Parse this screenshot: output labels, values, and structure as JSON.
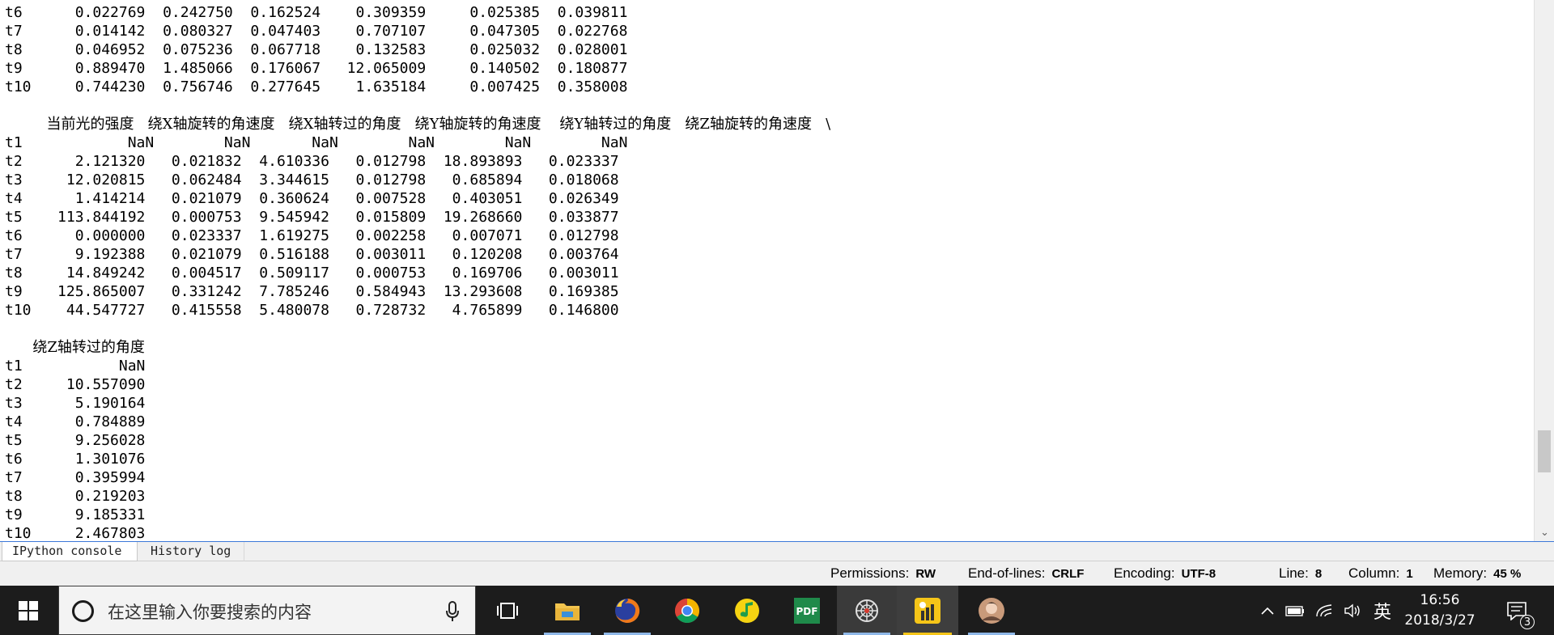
{
  "console": {
    "lines": [
      "t6      0.022769  0.242750  0.162524    0.309359     0.025385  0.039811",
      "t7      0.014142  0.080327  0.047403    0.707107     0.047305  0.022768",
      "t8      0.046952  0.075236  0.067718    0.132583     0.025032  0.028001",
      "t9      0.889470  1.485066  0.176067   12.065009     0.140502  0.180877",
      "t10     0.744230  0.756746  0.277645    1.635184     0.007425  0.358008",
      "",
      "         当前光的强度   绕X轴旋转的角速度   绕X轴转过的角度   绕Y轴旋转的角速度    绕Y轴转过的角度   绕Z轴旋转的角速度   \\",
      "t1            NaN        NaN       NaN        NaN        NaN        NaN",
      "t2      2.121320   0.021832  4.610336   0.012798  18.893893   0.023337",
      "t3     12.020815   0.062484  3.344615   0.012798   0.685894   0.018068",
      "t4      1.414214   0.021079  0.360624   0.007528   0.403051   0.026349",
      "t5    113.844192   0.000753  9.545942   0.015809  19.268660   0.033877",
      "t6      0.000000   0.023337  1.619275   0.002258   0.007071   0.012798",
      "t7      9.192388   0.021079  0.516188   0.003011   0.120208   0.003764",
      "t8     14.849242   0.004517  0.509117   0.000753   0.169706   0.003011",
      "t9    125.865007   0.331242  7.785246   0.584943  13.293608   0.169385",
      "t10    44.547727   0.415558  5.480078   0.728732   4.765899   0.146800",
      "",
      "      绕Z轴转过的角度",
      "t1           NaN",
      "t2     10.557090",
      "t3      5.190164",
      "t4      0.784889",
      "t5      9.256028",
      "t6      1.301076",
      "t7      0.395994",
      "t8      0.219203",
      "t9      9.185331",
      "t10     2.467803"
    ],
    "scroll_down_glyph": "⌄"
  },
  "tabs": {
    "ipython": "IPython console",
    "history": "History log"
  },
  "status": {
    "permissions_label": "Permissions:",
    "permissions_value": "RW",
    "eol_label": "End-of-lines:",
    "eol_value": "CRLF",
    "encoding_label": "Encoding:",
    "encoding_value": "UTF-8",
    "line_label": "Line:",
    "line_value": "8",
    "column_label": "Column:",
    "column_value": "1",
    "memory_label": "Memory:",
    "memory_value": "45 %"
  },
  "taskbar": {
    "search_placeholder": "在这里输入你要搜索的内容",
    "ime": "英",
    "time": "16:56",
    "date": "2018/3/27",
    "notification_count": "3",
    "accent": "#8fb8e8",
    "icons": [
      "windows-start-icon",
      "task-view-icon",
      "file-explorer-icon",
      "firefox-icon",
      "chrome-icon",
      "music-icon",
      "pdf-icon",
      "spider-icon",
      "pyspyder-icon",
      "avatar-icon"
    ]
  }
}
